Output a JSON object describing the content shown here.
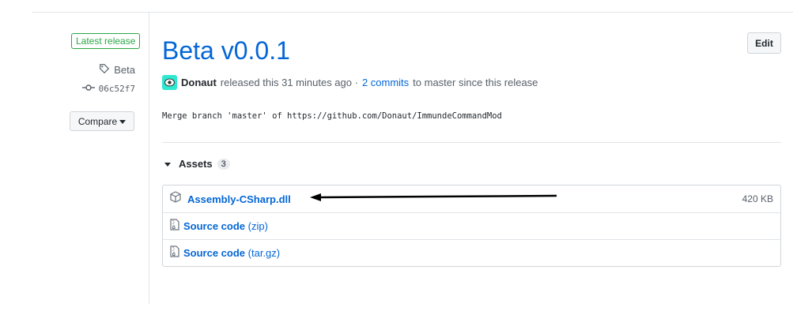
{
  "sidebar": {
    "latest_badge": "Latest release",
    "tag_name": "Beta",
    "commit_sha": "06c52f7",
    "compare_label": "Compare"
  },
  "release": {
    "title": "Beta v0.0.1",
    "edit_label": "Edit",
    "author": "Donaut",
    "released_text": "released this 31 minutes ago ·",
    "commits_link": "2 commits",
    "since_text": "to master since this release",
    "body": "Merge branch 'master' of https://github.com/Donaut/ImmundeCommandMod"
  },
  "assets": {
    "label": "Assets",
    "count": "3",
    "items": [
      {
        "name": "Assembly-CSharp.dll",
        "ext": "",
        "size": "420 KB",
        "icon": "package-icon"
      },
      {
        "name": "Source code",
        "ext": "(zip)",
        "size": "",
        "icon": "file-zip-icon"
      },
      {
        "name": "Source code",
        "ext": "(tar.gz)",
        "size": "",
        "icon": "file-zip-icon"
      }
    ]
  },
  "colors": {
    "link": "#0366d6",
    "latest": "#28a745",
    "avatar": "#2ee8d0"
  }
}
